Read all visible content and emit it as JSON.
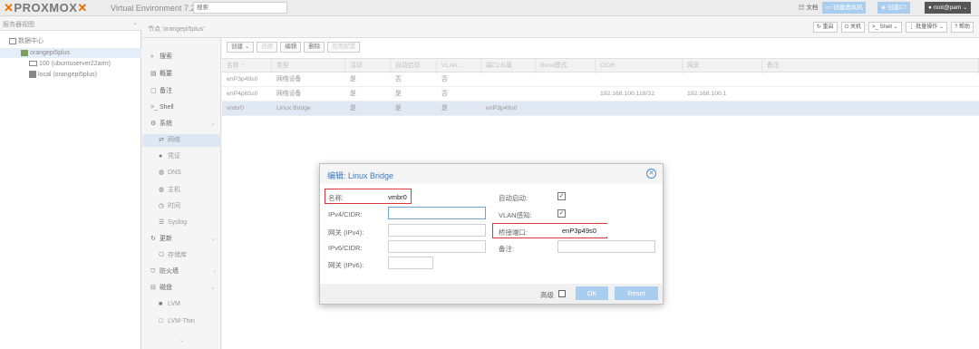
{
  "topbar": {
    "logo": "PROXMOX",
    "subtitle": "Virtual Environment 7.2-7",
    "search_placeholder": "搜索",
    "docs": "文档",
    "create_vm": "创建虚拟机",
    "create_ct": "创建CT",
    "user": "root@pam"
  },
  "tree": {
    "header": "服务器视图",
    "datacenter": "数据中心",
    "node": "orangepi5plus",
    "vm": "100 (ubuntuserver22arm)",
    "storage": "local (orangepi5plus)"
  },
  "node_header": {
    "title": "节点 'orangepi5plus'",
    "reboot": "重启",
    "shutdown": "关机",
    "shell": "Shell",
    "bulk": "批量操作",
    "help": "帮助"
  },
  "nav": {
    "search": "搜索",
    "summary": "概要",
    "notes": "备注",
    "shell": "Shell",
    "system": "系统",
    "network": "网络",
    "certs": "凭证",
    "dns": "DNS",
    "hosts": "主机",
    "time": "时间",
    "syslog": "Syslog",
    "updates": "更新",
    "repos": "存储库",
    "firewall": "防火墙",
    "disks": "磁盘",
    "lvm": "LVM",
    "lvmthin": "LVM-Thin"
  },
  "toolbar": {
    "create": "创建",
    "revert": "还原",
    "edit": "编辑",
    "remove": "删除",
    "apply": "应用配置"
  },
  "grid": {
    "headers": [
      "名称 ↑",
      "类型",
      "活动",
      "自动启动",
      "VLAN...",
      "端口/从属",
      "Bond模式",
      "CIDR",
      "网关",
      "备注"
    ],
    "rows": [
      [
        "enP3p49s0",
        "网络设备",
        "是",
        "否",
        "否",
        "",
        "",
        "",
        "",
        ""
      ],
      [
        "enP4p65s0",
        "网络设备",
        "是",
        "是",
        "否",
        "",
        "",
        "192.168.100.118/32",
        "192.168.100.1",
        ""
      ],
      [
        "vmbr0",
        "Linux Bridge",
        "是",
        "是",
        "是",
        "enP3p49s0",
        "",
        "",
        "",
        ""
      ]
    ]
  },
  "dialog": {
    "title": "编辑: Linux Bridge",
    "name_label": "名称:",
    "name_value": "vmbr0",
    "ipv4_label": "IPv4/CIDR:",
    "gw4_label": "网关 (IPv4):",
    "ipv6_label": "IPv6/CIDR:",
    "gw6_label": "网关 (IPv6):",
    "autostart_label": "自动启动:",
    "vlan_label": "VLAN感知:",
    "ports_label": "桥接端口:",
    "ports_value": "enP3p49s0",
    "comment_label": "备注:",
    "advanced": "高级",
    "ok": "OK",
    "reset": "Reset"
  },
  "colors": {
    "accent": "#3b7bbf",
    "highlight": "#d9373d",
    "button": "#a9cdee",
    "proxmox_orange": "#e57000"
  }
}
